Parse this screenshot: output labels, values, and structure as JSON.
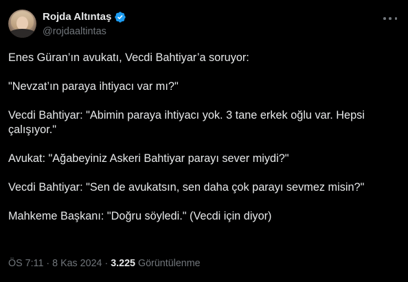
{
  "author": {
    "display_name": "Rojda Altıntaş",
    "handle": "@rojdaaltintas",
    "verified": true,
    "verified_color": "#1d9bf0",
    "avatar_icon": "profile-photo"
  },
  "tweet": {
    "paragraphs": [
      [
        "Enes Güran’ın avukatı, Vecdi Bahtiyar’a soruyor:"
      ],
      [
        "\"Nevzat’ın paraya ihtiyacı var mı?\""
      ],
      [
        "Vecdi Bahtiyar: \"Abimin paraya ihtiyacı yok. 3 tane erkek oğlu var. Hepsi",
        "çalışıyor.\""
      ],
      [
        "Avukat: \"Ağabeyiniz Askeri Bahtiyar parayı sever miydi?\""
      ],
      [
        "Vecdi Bahtiyar: \"Sen de avukatsın, sen daha çok parayı sevmez misin?\""
      ],
      [
        "Mahkeme Başkanı: \"Doğru söyledi.\" (Vecdi için diyor)"
      ]
    ]
  },
  "meta": {
    "time": "ÖS 7:11",
    "separator": "·",
    "date": "8 Kas 2024",
    "views_count": "3.225",
    "views_label": "Görüntülenme"
  },
  "theme": {
    "background": "#000000",
    "text": "#e7e9ea",
    "secondary_text": "#71767b"
  }
}
